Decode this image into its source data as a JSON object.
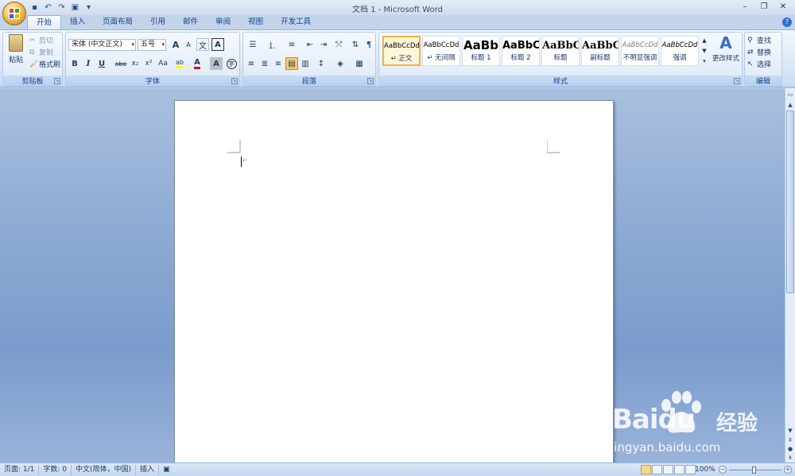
{
  "window": {
    "title": "文档 1 - Microsoft Word"
  },
  "qat": {
    "icons": [
      "save-icon",
      "undo-icon",
      "redo-icon",
      "print-preview-icon",
      "customize-icon"
    ]
  },
  "tabs": [
    "开始",
    "插入",
    "页面布局",
    "引用",
    "邮件",
    "审阅",
    "视图",
    "开发工具"
  ],
  "clipboard": {
    "paste": "粘贴",
    "cut": "剪切",
    "copy": "复制",
    "format_painter": "格式刷",
    "label": "剪贴板"
  },
  "font": {
    "name": "宋体 (中文正文)",
    "size": "五号",
    "grow": "A",
    "shrink": "A",
    "phonetic": "文",
    "border_char": "A",
    "bold": "B",
    "italic": "I",
    "underline": "U",
    "strike": "abe",
    "subscript": "x₂",
    "superscript": "x²",
    "case": "Aa",
    "highlight": "ab",
    "color": "A",
    "shading": "A",
    "enclose": "字",
    "label": "字体"
  },
  "paragraph": {
    "label": "段落"
  },
  "styles": {
    "label": "样式",
    "items": [
      {
        "sample": "AaBbCcDd",
        "name": "↵ 正文"
      },
      {
        "sample": "AaBbCcDd",
        "name": "↵ 无间隔"
      },
      {
        "sample": "AaBb",
        "name": "标题 1"
      },
      {
        "sample": "AaBbC",
        "name": "标题 2"
      },
      {
        "sample": "AaBbC",
        "name": "标题"
      },
      {
        "sample": "AaBbC",
        "name": "副标题"
      },
      {
        "sample": "AaBbCcDd",
        "name": "不明显强调"
      },
      {
        "sample": "AaBbCcDd",
        "name": "强调"
      }
    ],
    "change": "更改样式"
  },
  "editing": {
    "find": "查找",
    "replace": "替换",
    "select": "选择",
    "label": "编辑"
  },
  "document": {
    "cursor_mark": "↵"
  },
  "status": {
    "page": "页面: 1/1",
    "words": "字数: 0",
    "language": "中文(简体，中国)",
    "insert": "插入"
  },
  "zoom": {
    "level": "100%"
  },
  "watermark": {
    "brand": "Baidu",
    "cn": "经验",
    "url": "jingyan.baidu.com"
  }
}
